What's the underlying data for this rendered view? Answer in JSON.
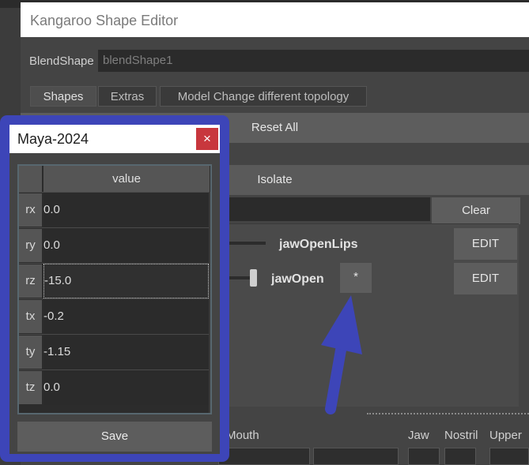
{
  "editor": {
    "title": "Kangaroo Shape Editor",
    "blendshape_label": "BlendShape",
    "blendshape_value": "blendShape1",
    "tabs": [
      {
        "label": "Shapes"
      },
      {
        "label": "Extras"
      },
      {
        "label": "Model Change different topology"
      }
    ],
    "reset_all_label": "Reset All",
    "isolate_label": "Isolate",
    "clear_label": "Clear",
    "shapes": [
      {
        "name": "jawOpenLips",
        "edit_label": "EDIT"
      },
      {
        "name": "jawOpen",
        "star_label": "*",
        "edit_label": "EDIT"
      }
    ],
    "columns": {
      "mouth": "Mouth",
      "jaw": "Jaw",
      "nostril": "Nostril",
      "upper": "Upper"
    }
  },
  "maya_dialog": {
    "title": "Maya-2024",
    "close_label": "×",
    "table_header": "value",
    "rows": [
      {
        "key": "rx",
        "value": "0.0"
      },
      {
        "key": "ry",
        "value": "0.0"
      },
      {
        "key": "rz",
        "value": "-15.0"
      },
      {
        "key": "tx",
        "value": "-0.2"
      },
      {
        "key": "ty",
        "value": "-1.15"
      },
      {
        "key": "tz",
        "value": "0.0"
      }
    ],
    "save_label": "Save"
  },
  "colors": {
    "annotation_blue": "#3d45b8",
    "close_red": "#c8373d",
    "panel_gray": "#444444"
  }
}
